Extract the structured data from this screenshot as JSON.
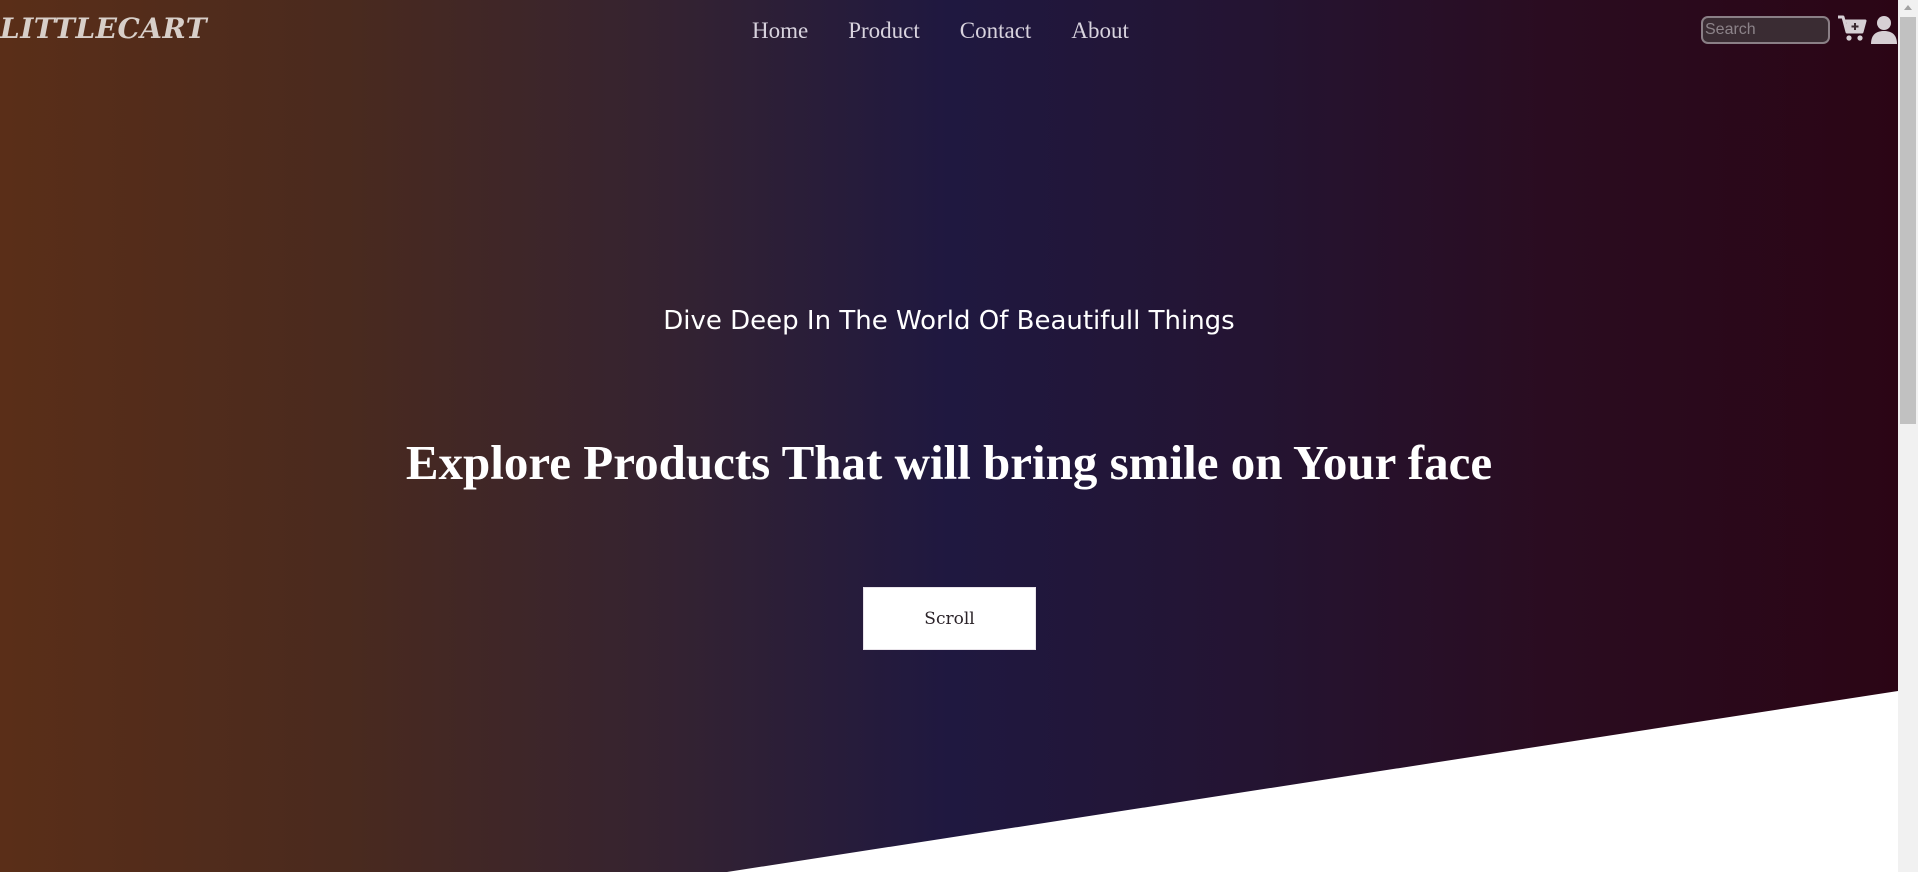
{
  "header": {
    "logo": "LITTLECART",
    "nav": [
      {
        "label": "Home"
      },
      {
        "label": "Product"
      },
      {
        "label": "Contact"
      },
      {
        "label": "About"
      }
    ],
    "search_placeholder": "Search",
    "icons": [
      "cart-plus-icon",
      "user-icon"
    ]
  },
  "hero": {
    "subtitle": "Dive Deep In The World Of Beautifull Things",
    "headline": "Explore Products That will bring smile on Your face",
    "button_label": "Scroll"
  },
  "colors": {
    "gradient_left": "#5a2e18",
    "gradient_mid": "#1f1840",
    "gradient_right": "#2b0515",
    "text": "#ffffff",
    "nav_text": "#d8d3de"
  }
}
